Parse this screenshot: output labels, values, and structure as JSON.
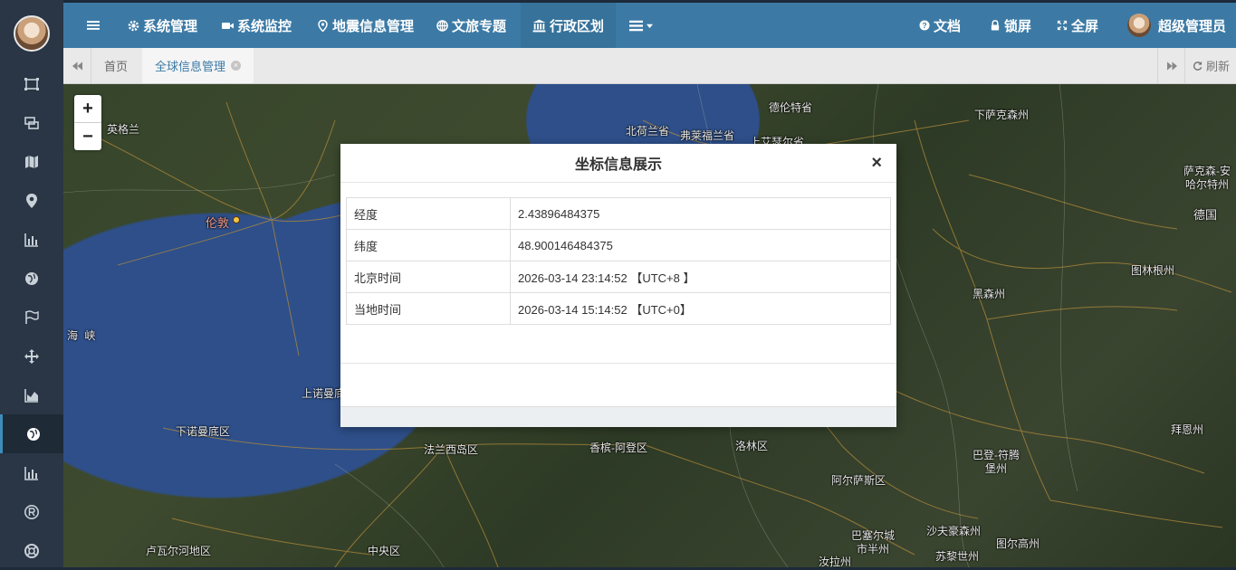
{
  "topbar": {
    "items": [
      {
        "label": "系统管理",
        "icon": "gear-icon"
      },
      {
        "label": "系统监控",
        "icon": "camera-icon"
      },
      {
        "label": "地震信息管理",
        "icon": "location-icon"
      },
      {
        "label": "文旅专题",
        "icon": "globe-icon"
      },
      {
        "label": "行政区划",
        "icon": "bank-icon"
      }
    ],
    "right": {
      "docs": "文档",
      "lock": "锁屏",
      "fullscreen": "全屏",
      "user": "超级管理员"
    }
  },
  "tabs": {
    "home": "首页",
    "active": "全球信息管理",
    "refresh": "刷新"
  },
  "map": {
    "labels": [
      {
        "text": "英格兰"
      },
      {
        "text": "伦敦"
      },
      {
        "text": "海 峡"
      },
      {
        "text": "下诺曼底区"
      },
      {
        "text": "上诺曼底"
      },
      {
        "text": "法兰西岛区"
      },
      {
        "text": "香槟-阿登区"
      },
      {
        "text": "洛林区"
      },
      {
        "text": "阿尔萨斯区"
      },
      {
        "text": "卢瓦尔河地区"
      },
      {
        "text": "中央区"
      },
      {
        "text": "北荷兰省"
      },
      {
        "text": "弗莱福兰省"
      },
      {
        "text": "德伦特省"
      },
      {
        "text": "上艾瑟尔省"
      },
      {
        "text": "下萨克森州"
      },
      {
        "text": "萨克森-安哈尔特州"
      },
      {
        "text": "德国"
      },
      {
        "text": "图林根州"
      },
      {
        "text": "黑森州"
      },
      {
        "text": "巴登-符腾堡州"
      },
      {
        "text": "拜恩州"
      },
      {
        "text": "巴塞尔城市半州"
      },
      {
        "text": "沙夫豪森州"
      },
      {
        "text": "图尔高州"
      },
      {
        "text": "苏黎世州"
      },
      {
        "text": "汝拉州"
      }
    ],
    "zoom_in": "+",
    "zoom_out": "−"
  },
  "modal": {
    "title": "坐标信息展示",
    "close": "×",
    "rows": [
      {
        "label": "经度",
        "value": "2.43896484375"
      },
      {
        "label": "纬度",
        "value": "48.900146484375"
      },
      {
        "label": "北京时间",
        "value": "2026-03-14 23:14:52 【UTC+8 】"
      },
      {
        "label": "当地时间",
        "value": "2026-03-14 15:14:52 【UTC+0】"
      }
    ]
  },
  "colors": {
    "topbar": "#3c7aa5",
    "sidebar": "#2a3645",
    "accent": "#3c8dbc"
  }
}
